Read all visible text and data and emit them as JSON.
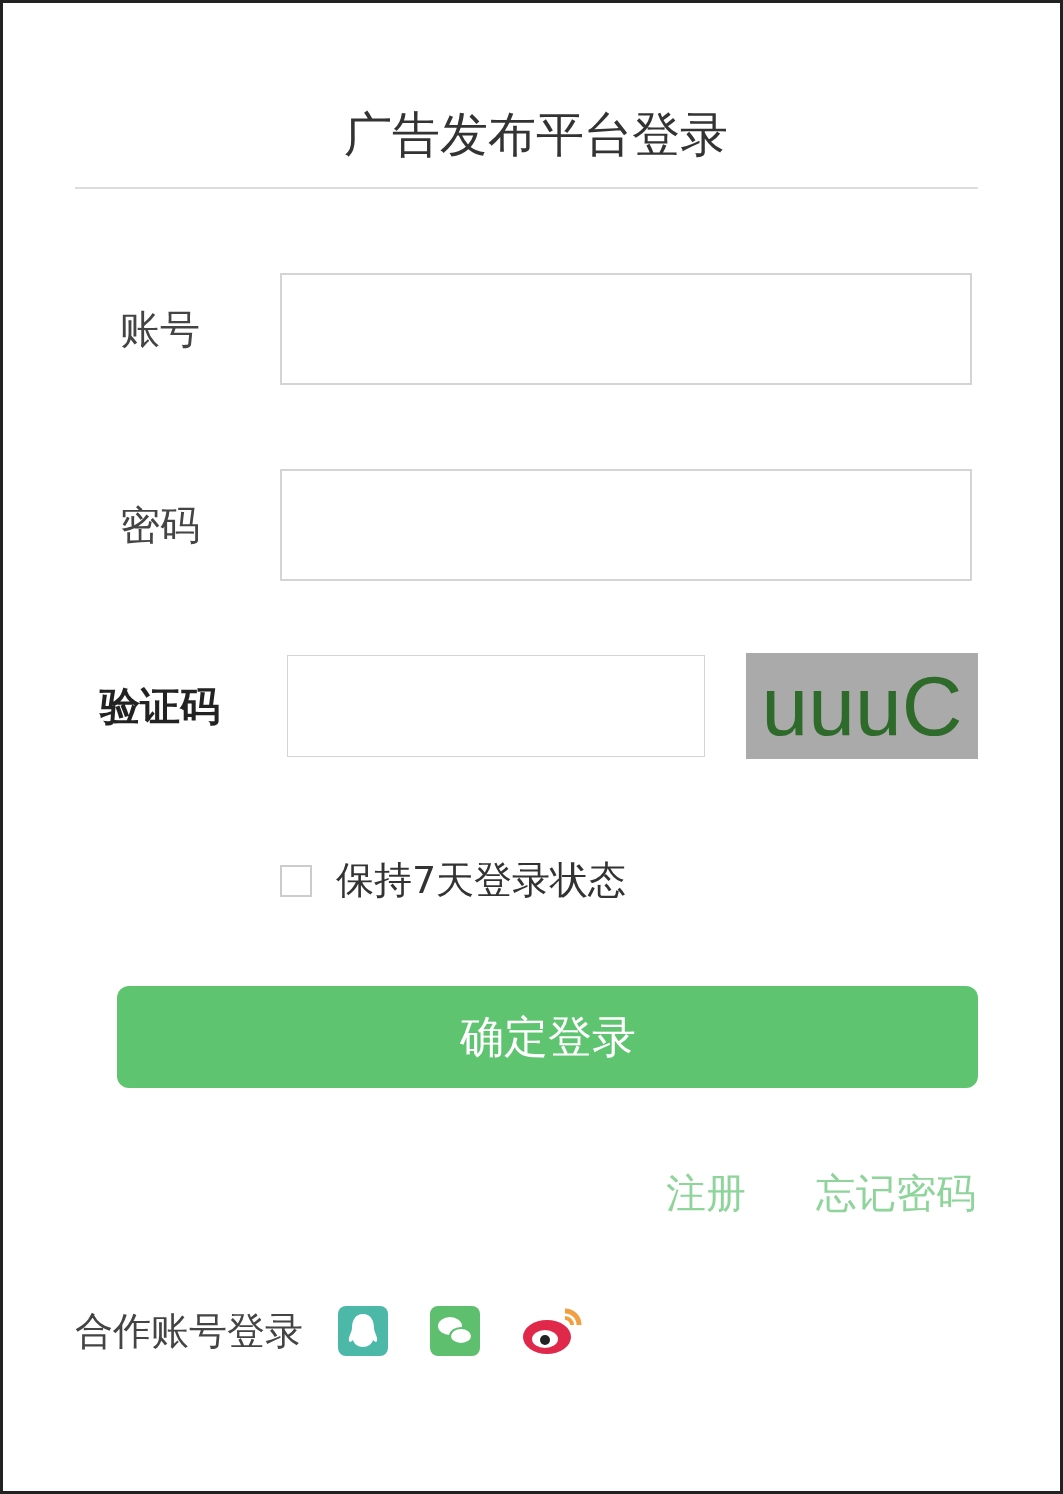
{
  "title": "广告发布平台登录",
  "fields": [
    {
      "label": "账号"
    },
    {
      "label": "密码"
    }
  ],
  "captcha": {
    "label": "验证码",
    "code": "uuuC"
  },
  "remember": {
    "label": "保持7天登录状态",
    "checked": false
  },
  "submit": "确定登录",
  "links": [
    "注册",
    "忘记密码"
  ],
  "partner": {
    "label": "合作账号登录",
    "providers": [
      {
        "kind": "qq"
      },
      {
        "kind": "wechat"
      },
      {
        "kind": "weibo"
      }
    ]
  }
}
